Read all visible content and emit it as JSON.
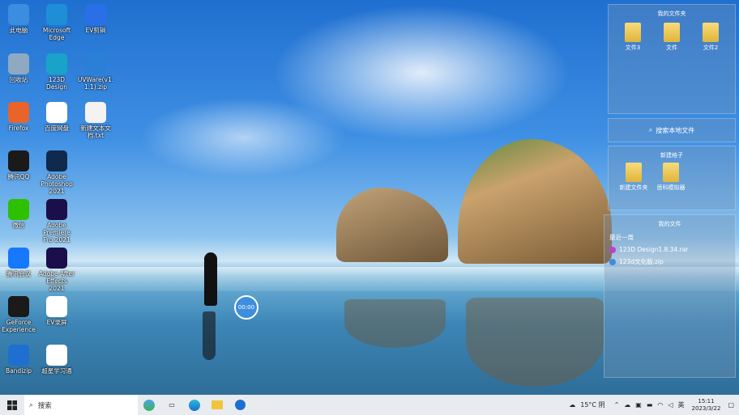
{
  "desktop_icons": [
    {
      "label": "此电脑",
      "icon": "computer-icon",
      "color": "#3b8de0"
    },
    {
      "label": "Microsoft Edge",
      "icon": "edge-icon",
      "color": "#1e8fd6"
    },
    {
      "label": "EV剪辑",
      "icon": "ev-clip-icon",
      "color": "#2a6fe8"
    },
    {
      "label": "回收站",
      "icon": "recycle-bin-icon",
      "color": "#8fa9c2"
    },
    {
      "label": "123D Design",
      "icon": "123d-design-icon",
      "color": "#1aa3c9"
    },
    {
      "label": "UVWare(v1.1.1).zip",
      "icon": "zip-icon",
      "color": "#2a7fd6"
    },
    {
      "label": "Firefox",
      "icon": "firefox-icon",
      "color": "#e8642b"
    },
    {
      "label": "百度网盘",
      "icon": "baidu-netdisk-icon",
      "color": "#ffffff"
    },
    {
      "label": "新建文本文档.txt",
      "icon": "text-file-icon",
      "color": "#f3f3f3"
    },
    {
      "label": "腾讯QQ",
      "icon": "qq-icon",
      "color": "#1a1a1a"
    },
    {
      "label": "Adobe Photoshop 2021",
      "icon": "photoshop-icon",
      "color": "#0f2a4d"
    },
    {
      "label": "微信",
      "icon": "wechat-icon",
      "color": "#2dc100"
    },
    {
      "label": "Adobe Premiere Pro 2021",
      "icon": "premiere-icon",
      "color": "#1a0f4a"
    },
    {
      "label": "腾讯会议",
      "icon": "tencent-meeting-icon",
      "color": "#1677ff"
    },
    {
      "label": "Adobe After Effects 2021",
      "icon": "after-effects-icon",
      "color": "#1a0f4a"
    },
    {
      "label": "GeForce Experience",
      "icon": "geforce-icon",
      "color": "#1a1a1a"
    },
    {
      "label": "EV录屏",
      "icon": "ev-recorder-icon",
      "color": "#ffffff"
    },
    {
      "label": "Bandizip",
      "icon": "bandizip-icon",
      "color": "#1e6fd0"
    },
    {
      "label": "超星学习通",
      "icon": "chaoxing-icon",
      "color": "#ffffff"
    }
  ],
  "widgets": {
    "my_folders": {
      "title": "我的文件夹",
      "items": [
        "文件3",
        "文件",
        "文件2"
      ]
    },
    "search": {
      "label": "搜索本地文件"
    },
    "new_box": {
      "title": "新建格子",
      "items": [
        "新建文件夹",
        "思科模拟器"
      ]
    },
    "my_files": {
      "title": "我的文件",
      "section": "最近一周",
      "files": [
        "123D Design1.8.34.rar",
        "123d文化版.zip"
      ]
    }
  },
  "timer": {
    "value": "00:00"
  },
  "taskbar": {
    "search_placeholder": "搜索",
    "weather": "15°C 阴",
    "ime": "英",
    "time": "15:11",
    "date": "2023/3/22"
  }
}
